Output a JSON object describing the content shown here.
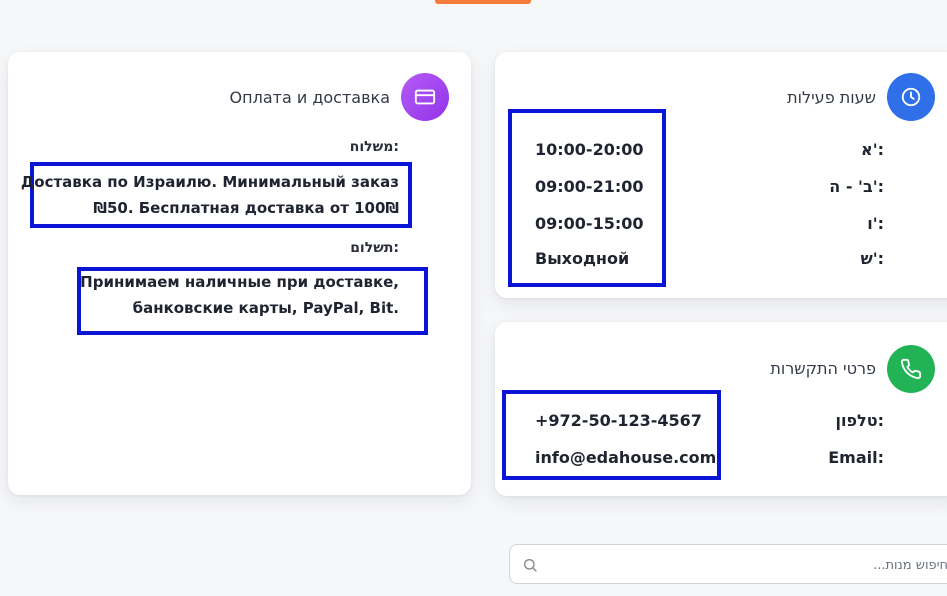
{
  "payment": {
    "title": "Оплата и доставка",
    "shipping_label": "משלוח:",
    "shipping_line1": "Доставка по Израилю. Минимальный заказ",
    "shipping_line2": "₪50. Бесплатная доставка от 100₪",
    "payment_label": "תשלום:",
    "payment_line1": "Принимаем наличные при доставке,",
    "payment_line2": "банковские карты, PayPal, Bit.",
    "icon": "credit-card-icon",
    "accent": "#a855f7"
  },
  "hours": {
    "title": "שעות פעילות",
    "icon": "clock-icon",
    "accent": "#2f6fe8",
    "rows": [
      {
        "day": "א':",
        "time": "10:00-20:00"
      },
      {
        "day": "ב' - ה':",
        "time": "09:00-21:00"
      },
      {
        "day": "ו':",
        "time": "09:00-15:00"
      },
      {
        "day": "ש':",
        "time": "Выходной"
      }
    ]
  },
  "contact": {
    "title": "פרטי התקשרות",
    "icon": "phone-icon",
    "accent": "#22b357",
    "phone_label": "טלפון:",
    "phone_value": "+972-50-123-4567",
    "email_label": "Email:",
    "email_value": "info@edahouse.com"
  },
  "search": {
    "placeholder": "חיפוש מנות...",
    "icon": "search-icon"
  },
  "highlight_color": "#0a14d6"
}
